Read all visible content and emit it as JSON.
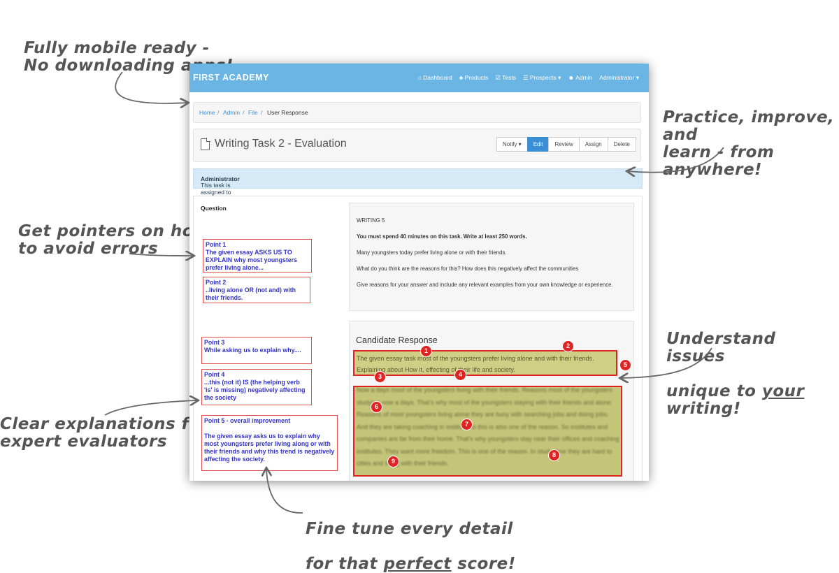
{
  "callouts": {
    "mobile": "Fully mobile ready -\nNo downloading apps!",
    "practice": "Practice, improve, and\nlearn - from anywhere!",
    "pointers": "Get pointers on how\nto avoid errors",
    "understand_1": "Understand issues",
    "understand_2": "unique to ",
    "understand_3": "your",
    "understand_4": " writing!",
    "clear": "Clear explanations from\nexpert evaluators",
    "finetune_1": "Fine tune every detail",
    "finetune_2": "for that ",
    "finetune_3": "perfect",
    "finetune_4": " score!"
  },
  "app": {
    "brand": "FIRST ACADEMY",
    "nav": [
      "⌂ Dashboard",
      "♣ Products",
      "☑ Tests",
      "☰ Prospects ▾",
      "☻ Admin",
      "Administrator ▾"
    ],
    "breadcrumb": [
      "Home",
      "Admin",
      "File",
      "User Response"
    ],
    "page_title": "Writing Task 2 - Evaluation",
    "buttons": [
      "Notify ▾",
      "Edit",
      "Review",
      "Assign",
      "Delete"
    ],
    "alert_prefix": "This task is assigned to ",
    "alert_user": "Administrator",
    "question_heading": "Question",
    "points": [
      "Point 1\nThe given essay ASKS US TO EXPLAIN why most youngsters prefer living alone...",
      "Point 2\n..living alone OR (not and) with their friends.",
      "Point 3\nWhile asking us to explain why....",
      "Point 4\n...this (not it) IS (the helping verb 'is' is missing) negatively affecting the society",
      "Point 5 - overall improvement\n\nThe given essay asks us to explain why most youngsters prefer living along or with their friends and why this trend is negatively affecting the society."
    ],
    "question_box": {
      "title": "WRITING 5",
      "instruction": "You must spend 40 minutes on this task. Write at least 250 words.",
      "p1": "Many youngsters today prefer living alone or with their friends.",
      "p2": "What do you think are the reasons for this? How does this negatively affect the communities",
      "p3": "Give reasons for your answer and include any relevant examples from your own knowledge or experience."
    },
    "response_heading": "Candidate Response",
    "response_p1": "The given essay task most of the youngsters prefer living alone and with their friends. Explaining about How it, effecting of their life and society.",
    "response_p2": "Now a days most of the youngsters living with their friends. Reasons most of the youngsters studying now a days. That's why most of the youngsters staying with their friends and alone. Reasons of most youngsters living alone they are busy with searching jobs and doing jobs. And they are taking coaching in institutions this is also one of the reason. So institutes and companies are far from their home. That's why youngsters stay near their offices and coaching institutes. They want more freedom. This is one of the reason. In study time they are hard to cities and living with their friends.",
    "markers": [
      "1",
      "2",
      "3",
      "4",
      "5",
      "6",
      "7",
      "8",
      "9"
    ]
  }
}
